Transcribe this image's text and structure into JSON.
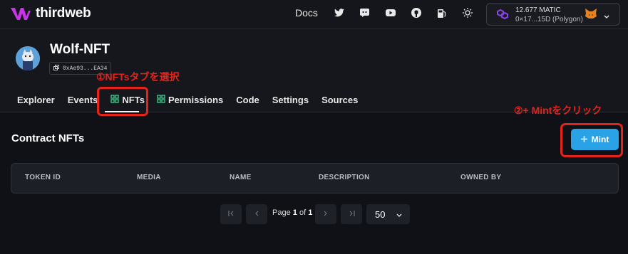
{
  "topbar": {
    "brand": "thirdweb",
    "docs_label": "Docs",
    "icons": [
      "twitter-icon",
      "discord-icon",
      "youtube-icon",
      "github-icon",
      "gas-icon",
      "theme-toggle-icon"
    ],
    "wallet": {
      "balance": "12.677 MATIC",
      "address": "0×17...15D (Polygon)"
    }
  },
  "contract": {
    "name": "Wolf-NFT",
    "address": "0xAe93...EA34"
  },
  "annotations": {
    "step1": "①NFTsタブを選択",
    "step2": "②+ Mintをクリック"
  },
  "tabs": [
    {
      "label": "Explorer"
    },
    {
      "label": "Events"
    },
    {
      "label": "NFTs",
      "active": true
    },
    {
      "label": "Permissions"
    },
    {
      "label": "Code"
    },
    {
      "label": "Settings"
    },
    {
      "label": "Sources"
    }
  ],
  "section": {
    "title": "Contract NFTs",
    "mint_label": "Mint"
  },
  "table": {
    "columns": [
      "TOKEN ID",
      "MEDIA",
      "NAME",
      "DESCRIPTION",
      "OWNED BY"
    ]
  },
  "pagination": {
    "page_prefix": "Page",
    "current": "1",
    "of_label": "of",
    "total": "1",
    "page_size": "50"
  },
  "colors": {
    "accent": "#2aa3e6",
    "annotation": "#e5231b",
    "background": "#0f1116",
    "tab_icon": "#3cc68a"
  }
}
